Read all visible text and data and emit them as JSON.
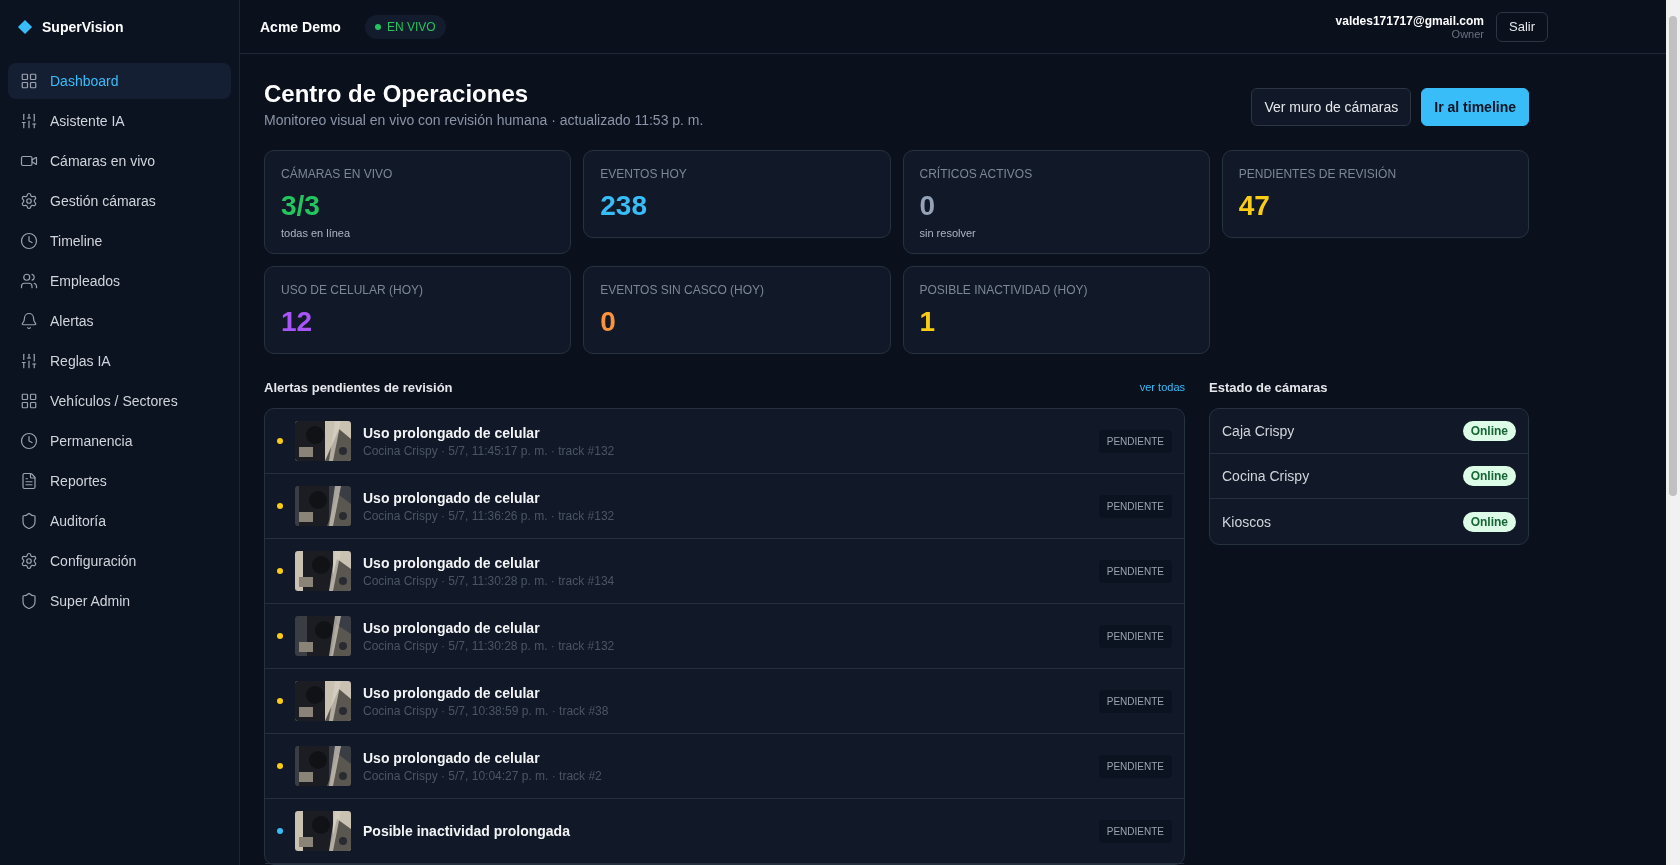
{
  "brand": "SuperVision",
  "sidebar": {
    "items": [
      {
        "label": "Dashboard",
        "selected": true
      },
      {
        "label": "Asistente IA",
        "selected": false
      },
      {
        "label": "Cámaras en vivo",
        "selected": false
      },
      {
        "label": "Gestión cámaras",
        "selected": false
      },
      {
        "label": "Timeline",
        "selected": false
      },
      {
        "label": "Empleados",
        "selected": false
      },
      {
        "label": "Alertas",
        "selected": false
      },
      {
        "label": "Reglas IA",
        "selected": false
      },
      {
        "label": "Vehículos / Sectores",
        "selected": false
      },
      {
        "label": "Permanencia",
        "selected": false
      },
      {
        "label": "Reportes",
        "selected": false
      },
      {
        "label": "Auditoría",
        "selected": false
      },
      {
        "label": "Configuración",
        "selected": false
      },
      {
        "label": "Super Admin",
        "selected": false
      }
    ]
  },
  "topbar": {
    "org": "Acme Demo",
    "live_badge": "EN VIVO",
    "user_email": "valdes171717@gmail.com",
    "user_role": "Owner",
    "logout": "Salir"
  },
  "page": {
    "title": "Centro de Operaciones",
    "subtitle": "Monitoreo visual en vivo con revisión humana · actualizado 11:53 p. m.",
    "buttons": [
      {
        "label": "Ver muro de cámaras",
        "kind": "secondary"
      },
      {
        "label": "Ir al timeline",
        "kind": "primary"
      }
    ]
  },
  "stats": [
    {
      "label": "CÁMARAS EN VIVO",
      "value": "3/3",
      "note": "todas en línea",
      "color": "#22c55e"
    },
    {
      "label": "EVENTOS HOY",
      "value": "238",
      "color": "#38bdf8"
    },
    {
      "label": "CRÍTICOS ACTIVOS",
      "value": "0",
      "note": "sin resolver",
      "color": "#94a3b8"
    },
    {
      "label": "PENDIENTES DE REVISIÓN",
      "value": "47",
      "color": "#facc15"
    },
    {
      "label": "USO DE CELULAR (HOY)",
      "value": "12",
      "color": "#a855f7"
    },
    {
      "label": "EVENTOS SIN CASCO (HOY)",
      "value": "0",
      "color": "#fb923c"
    },
    {
      "label": "POSIBLE INACTIVIDAD (HOY)",
      "value": "1",
      "color": "#facc15"
    }
  ],
  "alerts": {
    "title": "Alertas pendientes de revisión",
    "link": "ver todas",
    "items": [
      {
        "title": "Uso prolongado de celular",
        "meta": "Cocina Crispy · 5/7, 11:45:17 p. m. · track #132",
        "status": "PENDIENTE",
        "color": "#facc15"
      },
      {
        "title": "Uso prolongado de celular",
        "meta": "Cocina Crispy · 5/7, 11:36:26 p. m. · track #132",
        "status": "PENDIENTE",
        "color": "#facc15"
      },
      {
        "title": "Uso prolongado de celular",
        "meta": "Cocina Crispy · 5/7, 11:30:28 p. m. · track #134",
        "status": "PENDIENTE",
        "color": "#facc15"
      },
      {
        "title": "Uso prolongado de celular",
        "meta": "Cocina Crispy · 5/7, 11:30:28 p. m. · track #132",
        "status": "PENDIENTE",
        "color": "#facc15"
      },
      {
        "title": "Uso prolongado de celular",
        "meta": "Cocina Crispy · 5/7, 10:38:59 p. m. · track #38",
        "status": "PENDIENTE",
        "color": "#facc15"
      },
      {
        "title": "Uso prolongado de celular",
        "meta": "Cocina Crispy · 5/7, 10:04:27 p. m. · track #2",
        "status": "PENDIENTE",
        "color": "#facc15"
      },
      {
        "title": "Posible inactividad prolongada",
        "status": "PENDIENTE",
        "color": "#38bdf8"
      }
    ]
  },
  "cameras": {
    "title": "Estado de cámaras",
    "items": [
      {
        "name": "Caja Crispy",
        "status": "Online"
      },
      {
        "name": "Cocina Crispy",
        "status": "Online"
      },
      {
        "name": "Kioscos",
        "status": "Online"
      }
    ]
  }
}
